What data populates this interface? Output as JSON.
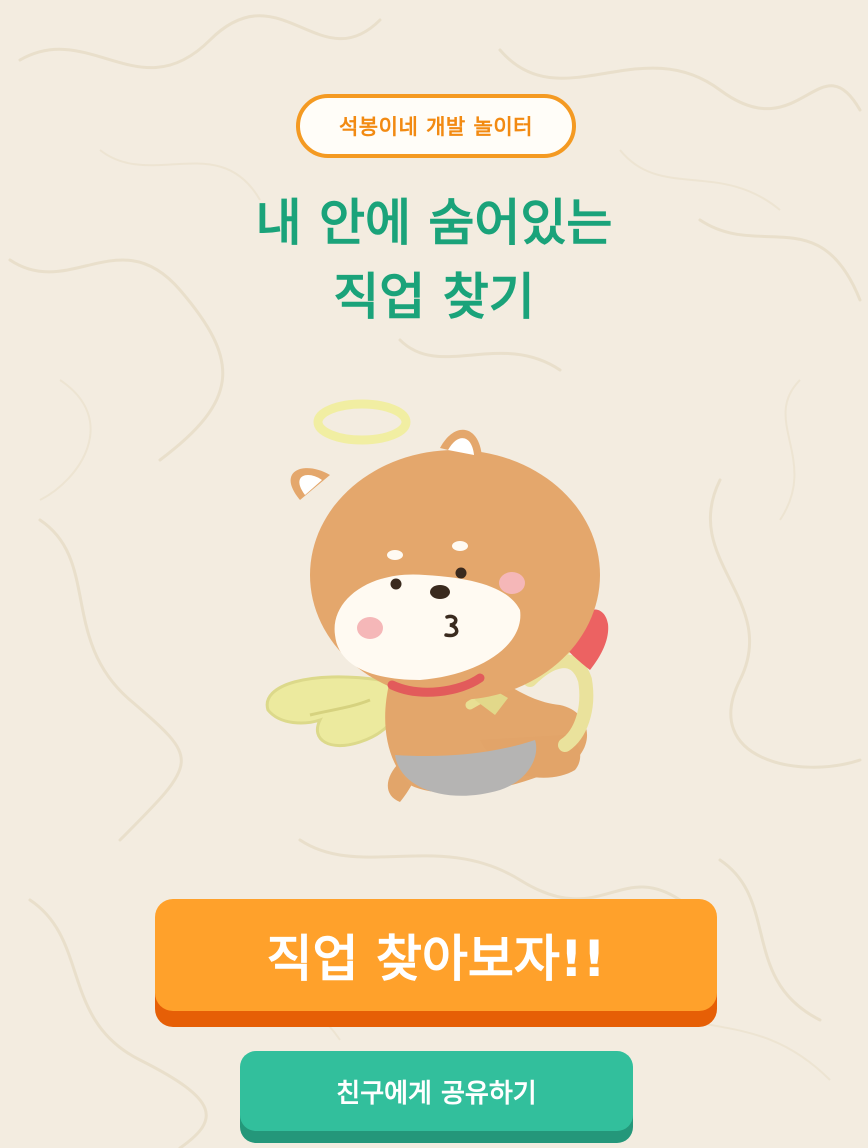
{
  "header": {
    "badge_label": "석봉이네 개발 놀이터"
  },
  "hero": {
    "title_line1": "내 안에 숨어있는",
    "title_line2": "직업 찾기"
  },
  "actions": {
    "start_label": "직업 찾아보자!!",
    "share_label": "친구에게 공유하기"
  },
  "colors": {
    "background": "#f3ece0",
    "accent_orange": "#ffa12b",
    "accent_green": "#1aa37a",
    "share_green": "#32bf9c"
  },
  "illustration": {
    "icon": "angel-shiba-dog-cupid-icon"
  }
}
